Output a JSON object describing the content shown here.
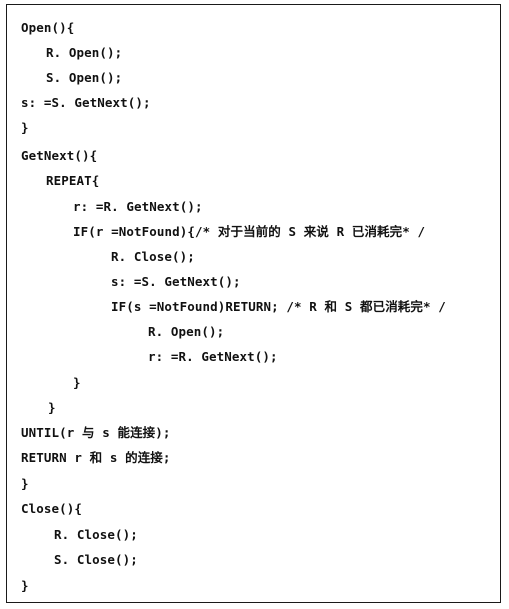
{
  "code_lines": [
    {
      "text": "Open(){"
    },
    {
      "text": "R. Open();"
    },
    {
      "text": "S. Open();"
    },
    {
      "text": "s: =S. GetNext();"
    },
    {
      "text": "}"
    },
    {
      "text": "GetNext(){"
    },
    {
      "text": "REPEAT{"
    },
    {
      "text": "r: =R. GetNext();"
    },
    {
      "text": "IF(r =NotFound){/* 对于当前的 S 来说 R 已消耗完* /"
    },
    {
      "text": "R. Close();"
    },
    {
      "text": "s: =S. GetNext();"
    },
    {
      "text": "IF(s =NotFound)RETURN; /* R 和 S 都已消耗完* /"
    },
    {
      "text": "R. Open();"
    },
    {
      "text": "r: =R. GetNext();"
    },
    {
      "text": "}"
    },
    {
      "text": "}"
    },
    {
      "text": "UNTIL(r 与 s 能连接);"
    },
    {
      "text": "RETURN r 和 s 的连接;"
    },
    {
      "text": "}"
    },
    {
      "text": "Close(){"
    },
    {
      "text": "R. Close();"
    },
    {
      "text": "S. Close();"
    },
    {
      "text": "}"
    }
  ]
}
